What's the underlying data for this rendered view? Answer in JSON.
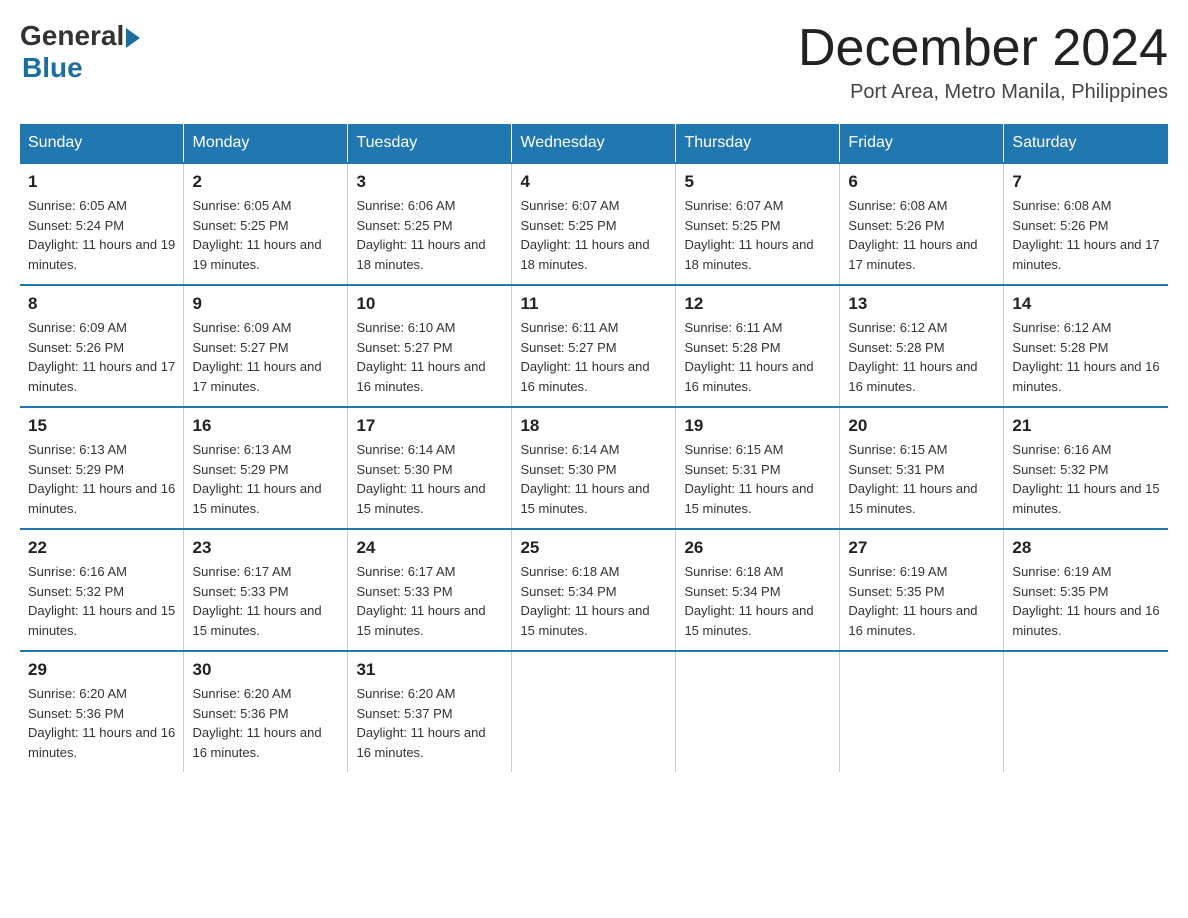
{
  "header": {
    "logo_general": "General",
    "logo_blue": "Blue",
    "month_title": "December 2024",
    "location": "Port Area, Metro Manila, Philippines"
  },
  "days_of_week": [
    "Sunday",
    "Monday",
    "Tuesday",
    "Wednesday",
    "Thursday",
    "Friday",
    "Saturday"
  ],
  "weeks": [
    [
      {
        "day": "1",
        "sunrise": "6:05 AM",
        "sunset": "5:24 PM",
        "daylight": "11 hours and 19 minutes."
      },
      {
        "day": "2",
        "sunrise": "6:05 AM",
        "sunset": "5:25 PM",
        "daylight": "11 hours and 19 minutes."
      },
      {
        "day": "3",
        "sunrise": "6:06 AM",
        "sunset": "5:25 PM",
        "daylight": "11 hours and 18 minutes."
      },
      {
        "day": "4",
        "sunrise": "6:07 AM",
        "sunset": "5:25 PM",
        "daylight": "11 hours and 18 minutes."
      },
      {
        "day": "5",
        "sunrise": "6:07 AM",
        "sunset": "5:25 PM",
        "daylight": "11 hours and 18 minutes."
      },
      {
        "day": "6",
        "sunrise": "6:08 AM",
        "sunset": "5:26 PM",
        "daylight": "11 hours and 17 minutes."
      },
      {
        "day": "7",
        "sunrise": "6:08 AM",
        "sunset": "5:26 PM",
        "daylight": "11 hours and 17 minutes."
      }
    ],
    [
      {
        "day": "8",
        "sunrise": "6:09 AM",
        "sunset": "5:26 PM",
        "daylight": "11 hours and 17 minutes."
      },
      {
        "day": "9",
        "sunrise": "6:09 AM",
        "sunset": "5:27 PM",
        "daylight": "11 hours and 17 minutes."
      },
      {
        "day": "10",
        "sunrise": "6:10 AM",
        "sunset": "5:27 PM",
        "daylight": "11 hours and 16 minutes."
      },
      {
        "day": "11",
        "sunrise": "6:11 AM",
        "sunset": "5:27 PM",
        "daylight": "11 hours and 16 minutes."
      },
      {
        "day": "12",
        "sunrise": "6:11 AM",
        "sunset": "5:28 PM",
        "daylight": "11 hours and 16 minutes."
      },
      {
        "day": "13",
        "sunrise": "6:12 AM",
        "sunset": "5:28 PM",
        "daylight": "11 hours and 16 minutes."
      },
      {
        "day": "14",
        "sunrise": "6:12 AM",
        "sunset": "5:28 PM",
        "daylight": "11 hours and 16 minutes."
      }
    ],
    [
      {
        "day": "15",
        "sunrise": "6:13 AM",
        "sunset": "5:29 PM",
        "daylight": "11 hours and 16 minutes."
      },
      {
        "day": "16",
        "sunrise": "6:13 AM",
        "sunset": "5:29 PM",
        "daylight": "11 hours and 15 minutes."
      },
      {
        "day": "17",
        "sunrise": "6:14 AM",
        "sunset": "5:30 PM",
        "daylight": "11 hours and 15 minutes."
      },
      {
        "day": "18",
        "sunrise": "6:14 AM",
        "sunset": "5:30 PM",
        "daylight": "11 hours and 15 minutes."
      },
      {
        "day": "19",
        "sunrise": "6:15 AM",
        "sunset": "5:31 PM",
        "daylight": "11 hours and 15 minutes."
      },
      {
        "day": "20",
        "sunrise": "6:15 AM",
        "sunset": "5:31 PM",
        "daylight": "11 hours and 15 minutes."
      },
      {
        "day": "21",
        "sunrise": "6:16 AM",
        "sunset": "5:32 PM",
        "daylight": "11 hours and 15 minutes."
      }
    ],
    [
      {
        "day": "22",
        "sunrise": "6:16 AM",
        "sunset": "5:32 PM",
        "daylight": "11 hours and 15 minutes."
      },
      {
        "day": "23",
        "sunrise": "6:17 AM",
        "sunset": "5:33 PM",
        "daylight": "11 hours and 15 minutes."
      },
      {
        "day": "24",
        "sunrise": "6:17 AM",
        "sunset": "5:33 PM",
        "daylight": "11 hours and 15 minutes."
      },
      {
        "day": "25",
        "sunrise": "6:18 AM",
        "sunset": "5:34 PM",
        "daylight": "11 hours and 15 minutes."
      },
      {
        "day": "26",
        "sunrise": "6:18 AM",
        "sunset": "5:34 PM",
        "daylight": "11 hours and 15 minutes."
      },
      {
        "day": "27",
        "sunrise": "6:19 AM",
        "sunset": "5:35 PM",
        "daylight": "11 hours and 16 minutes."
      },
      {
        "day": "28",
        "sunrise": "6:19 AM",
        "sunset": "5:35 PM",
        "daylight": "11 hours and 16 minutes."
      }
    ],
    [
      {
        "day": "29",
        "sunrise": "6:20 AM",
        "sunset": "5:36 PM",
        "daylight": "11 hours and 16 minutes."
      },
      {
        "day": "30",
        "sunrise": "6:20 AM",
        "sunset": "5:36 PM",
        "daylight": "11 hours and 16 minutes."
      },
      {
        "day": "31",
        "sunrise": "6:20 AM",
        "sunset": "5:37 PM",
        "daylight": "11 hours and 16 minutes."
      },
      null,
      null,
      null,
      null
    ]
  ]
}
